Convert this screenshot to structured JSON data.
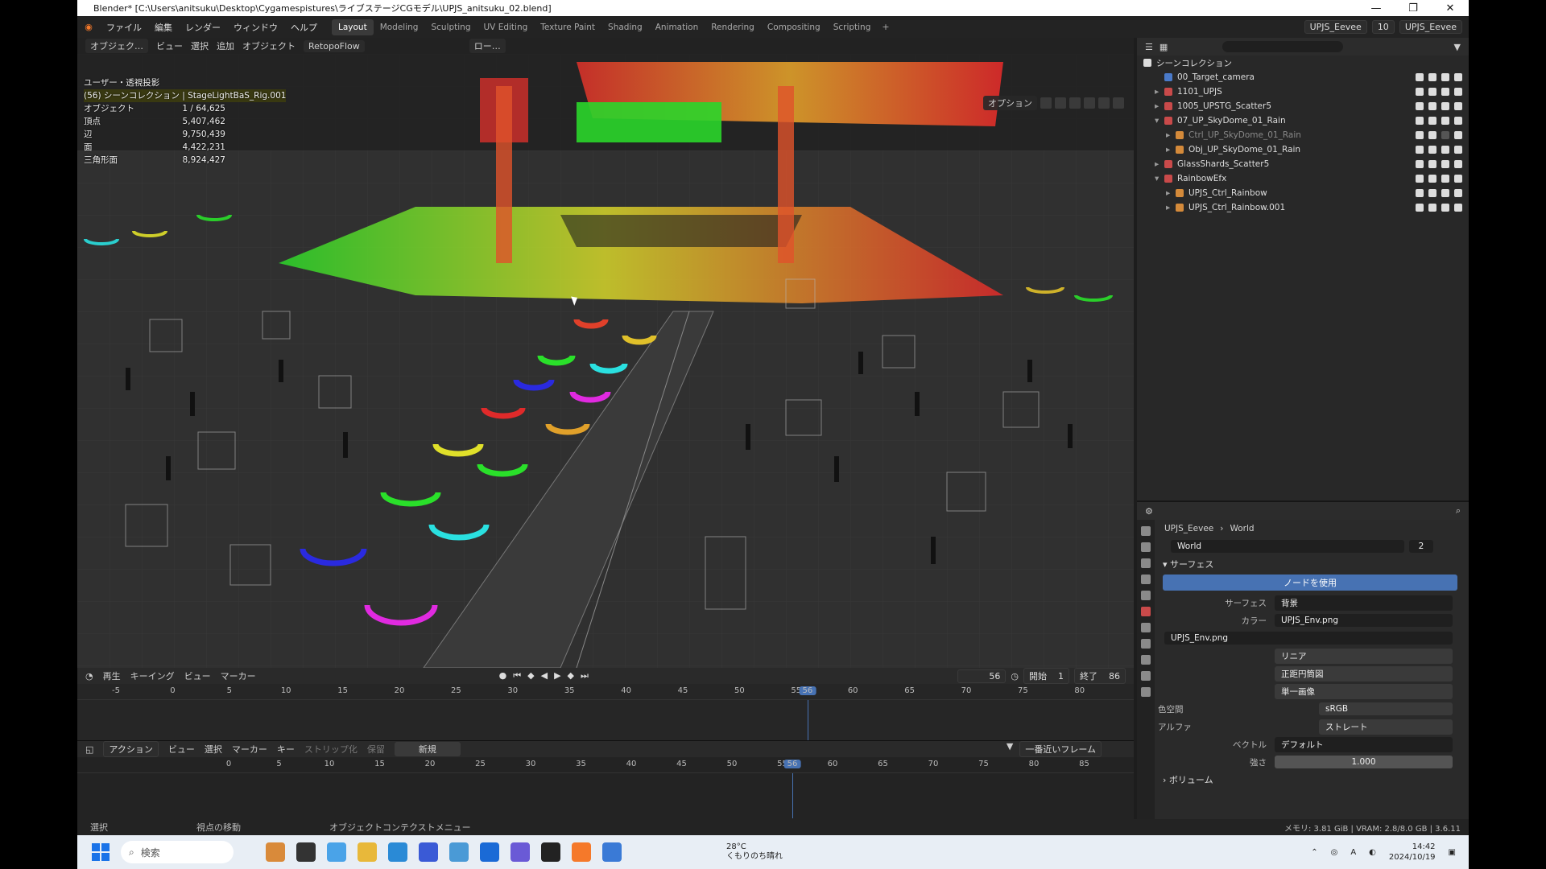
{
  "window": {
    "title": "Blender* [C:\\Users\\anitsuku\\Desktop\\Cygamespistures\\ライブステージCGモデル\\UPJS_anitsuku_02.blend]"
  },
  "menu": [
    "ファイル",
    "編集",
    "レンダー",
    "ウィンドウ",
    "ヘルプ"
  ],
  "workspaces": [
    {
      "label": "Layout",
      "active": true
    },
    {
      "label": "Modeling"
    },
    {
      "label": "Sculpting"
    },
    {
      "label": "UV Editing"
    },
    {
      "label": "Texture Paint"
    },
    {
      "label": "Shading"
    },
    {
      "label": "Animation"
    },
    {
      "label": "Rendering"
    },
    {
      "label": "Compositing"
    },
    {
      "label": "Scripting"
    }
  ],
  "scene": {
    "name": "UPJS_Eevee",
    "frame_count": "10",
    "view_layer": "UPJS_Eevee"
  },
  "viewport_header": {
    "mode": "オブジェク…",
    "menus": [
      "ビュー",
      "選択",
      "追加",
      "オブジェクト"
    ],
    "addon": "RetopoFlow",
    "transform": "ロー…",
    "options": "オプション"
  },
  "overlay": {
    "view_name": "ユーザー・透視投影",
    "collection": "(56) シーンコレクション | StageLightBaS_Rig.001",
    "stats": [
      {
        "k": "オブジェクト",
        "v": "1 / 64,625"
      },
      {
        "k": "頂点",
        "v": "5,407,462"
      },
      {
        "k": "辺",
        "v": "9,750,439"
      },
      {
        "k": "面",
        "v": "4,422,231"
      },
      {
        "k": "三角形面",
        "v": "8,924,427"
      }
    ]
  },
  "timeline": {
    "menus": [
      "再生",
      "キーイング",
      "ビュー",
      "マーカー"
    ],
    "current_frame": "56",
    "start_label": "開始",
    "start": "1",
    "end_label": "終了",
    "end": "86",
    "ruler": [
      "-5",
      "0",
      "5",
      "10",
      "15",
      "20",
      "25",
      "30",
      "35",
      "40",
      "45",
      "50",
      "55",
      "60",
      "65",
      "70",
      "75",
      "80"
    ],
    "playhead": "56"
  },
  "action_editor": {
    "mode": "アクション",
    "menus": [
      "ビュー",
      "選択",
      "マーカー",
      "キー"
    ],
    "strip": "ストリップ化",
    "keep": "保留",
    "new": "新規",
    "snap": "一番近いフレーム",
    "ruler": [
      "0",
      "5",
      "10",
      "15",
      "20",
      "25",
      "30",
      "35",
      "40",
      "45",
      "50",
      "55",
      "60",
      "65",
      "70",
      "75",
      "80",
      "85"
    ],
    "playhead": "56"
  },
  "outliner": {
    "root": "シーンコレクション",
    "items": [
      {
        "label": "00_Target_camera",
        "indent": 1,
        "color": "#4a7ac9",
        "arrow": ""
      },
      {
        "label": "1101_UPJS",
        "indent": 1,
        "color": "#c94a4a",
        "arrow": "▸"
      },
      {
        "label": "1005_UPSTG_Scatter5",
        "indent": 1,
        "color": "#c94a4a",
        "arrow": "▸"
      },
      {
        "label": "07_UP_SkyDome_01_Rain",
        "indent": 1,
        "color": "#c94a4a",
        "arrow": "▾"
      },
      {
        "label": "Ctrl_UP_SkyDome_01_Rain",
        "indent": 2,
        "color": "#d48a3a",
        "arrow": "▸",
        "dim": true
      },
      {
        "label": "Obj_UP_SkyDome_01_Rain",
        "indent": 2,
        "color": "#d48a3a",
        "arrow": "▸"
      },
      {
        "label": "GlassShards_Scatter5",
        "indent": 1,
        "color": "#c94a4a",
        "arrow": "▸"
      },
      {
        "label": "RainbowEfx",
        "indent": 1,
        "color": "#c94a4a",
        "arrow": "▾"
      },
      {
        "label": "UPJS_Ctrl_Rainbow",
        "indent": 2,
        "color": "#d48a3a",
        "arrow": "▸"
      },
      {
        "label": "UPJS_Ctrl_Rainbow.001",
        "indent": 2,
        "color": "#d48a3a",
        "arrow": "▸"
      }
    ]
  },
  "properties": {
    "breadcrumb": [
      "UPJS_Eevee",
      "World"
    ],
    "world_name": "World",
    "users": "2",
    "section_surface": "サーフェス",
    "use_nodes": "ノードを使用",
    "fields": [
      {
        "label": "サーフェス",
        "value": "背景",
        "style": "dark"
      },
      {
        "label": "カラー",
        "value": "UPJS_Env.png",
        "style": "dark"
      }
    ],
    "image_name": "UPJS_Env.png",
    "image_opts": [
      "リニア",
      "正距円筒図",
      "単一画像"
    ],
    "color_space_label": "色空間",
    "color_space": "sRGB",
    "alpha_label": "アルファ",
    "alpha": "ストレート",
    "vector_label": "ベクトル",
    "vector": "デフォルト",
    "strength_label": "強さ",
    "strength": "1.000",
    "section_volume": "ボリューム"
  },
  "statusbar": {
    "items": [
      "選択",
      "視点の移動",
      "オブジェクトコンテクストメニュー"
    ],
    "memory": "メモリ: 3.81 GiB | VRAM: 2.8/8.0 GB | 3.6.11"
  },
  "taskbar": {
    "search": "検索",
    "weather_temp": "28°C",
    "weather_desc": "くもりのち晴れ",
    "time": "14:42",
    "date": "2024/10/19"
  }
}
